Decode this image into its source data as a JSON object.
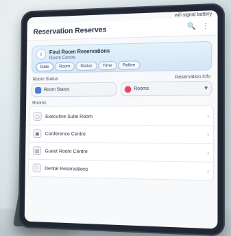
{
  "app": {
    "title": "Reservation Reserves"
  },
  "status_bar": {
    "time": "",
    "icons": "wifi signal battery"
  },
  "header": {
    "search_icon": "search-icon",
    "more_icon": "more-icon"
  },
  "summary": {
    "title": "Find Room Reservations",
    "subtitle": "Room Centre",
    "filters": [
      {
        "label": "Date"
      },
      {
        "label": "Room"
      },
      {
        "label": "Status"
      },
      {
        "label": "Time"
      },
      {
        "label": "Refine"
      }
    ],
    "icon": "info-icon"
  },
  "sections": {
    "left_label": "Room Status",
    "right_label": "Reservation Info"
  },
  "selects": {
    "room": {
      "label": "Room Status"
    },
    "status": {
      "label": "Rooms",
      "chevron_icon": "chevron-down-icon"
    }
  },
  "list_section": {
    "label": "Rooms",
    "items": [
      {
        "label": "Executive Suite Room",
        "icon": "room-icon"
      },
      {
        "label": "Conference Centre",
        "icon": "conference-icon"
      },
      {
        "label": "Guest Room Centre",
        "icon": "guestroom-icon"
      },
      {
        "label": "Dental Reservations",
        "icon": "reservation-icon"
      }
    ]
  }
}
